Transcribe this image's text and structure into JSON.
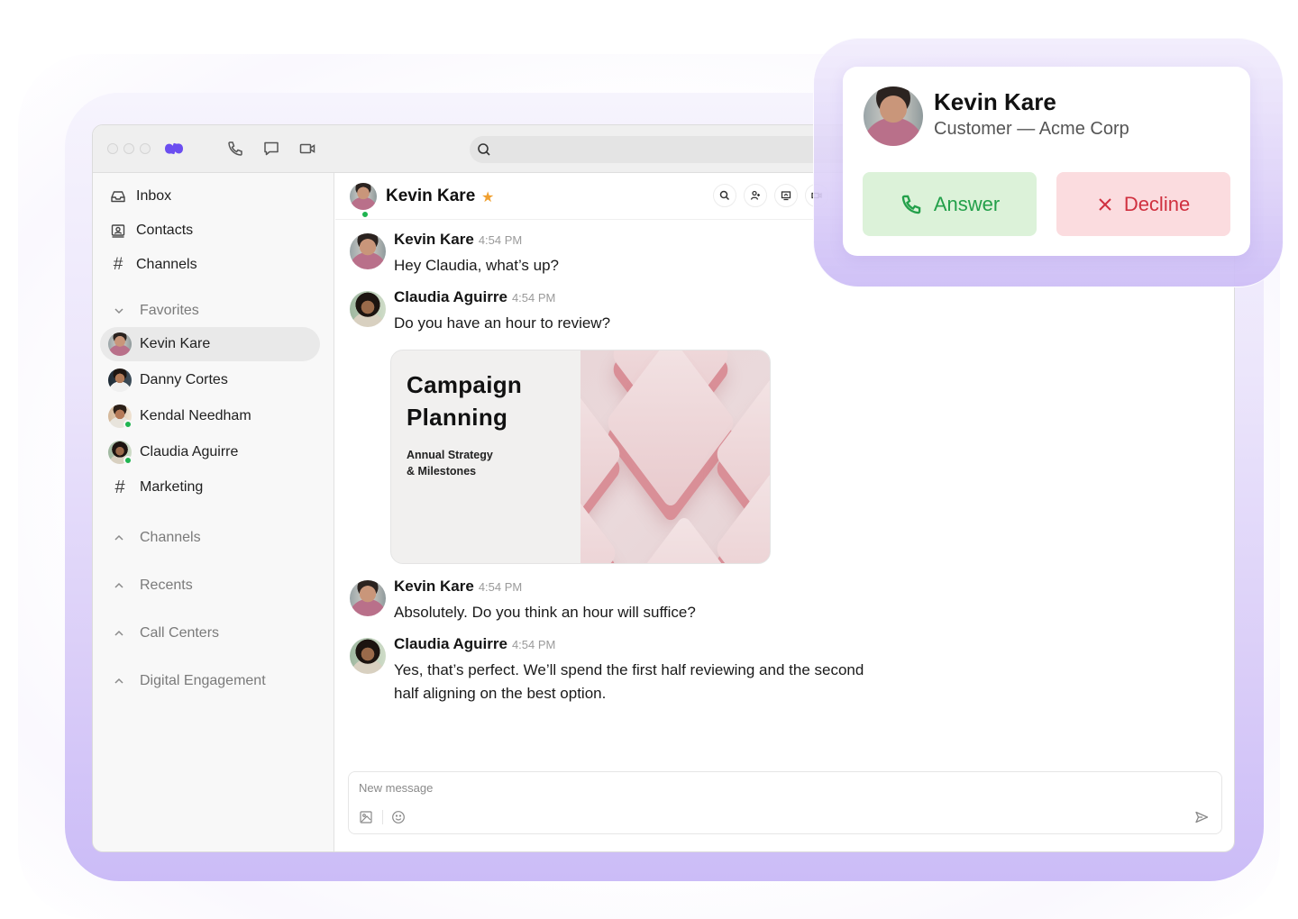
{
  "titlebar": {
    "logo": "app-logo",
    "icons": [
      "phone-icon",
      "chat-bubble-icon",
      "video-camera-icon"
    ],
    "search_placeholder": ""
  },
  "sidebar": {
    "nav": [
      {
        "label": "Inbox",
        "icon": "inbox-icon"
      },
      {
        "label": "Contacts",
        "icon": "contacts-icon"
      },
      {
        "label": "Channels",
        "icon": "hash-icon"
      }
    ],
    "favorites_label": "Favorites",
    "favorites": [
      {
        "label": "Kevin Kare",
        "type": "person",
        "online": false,
        "active": true
      },
      {
        "label": "Danny Cortes",
        "type": "person",
        "online": false,
        "active": false
      },
      {
        "label": "Kendal Needham",
        "type": "person",
        "online": true,
        "active": false
      },
      {
        "label": "Claudia Aguirre",
        "type": "person",
        "online": true,
        "active": false
      },
      {
        "label": "Marketing",
        "type": "channel",
        "online": false,
        "active": false
      }
    ],
    "sections": [
      {
        "label": "Channels"
      },
      {
        "label": "Recents"
      },
      {
        "label": "Call Centers"
      },
      {
        "label": "Digital Engagement"
      }
    ]
  },
  "chat": {
    "header": {
      "name": "Kevin Kare",
      "starred": true,
      "online": true,
      "actions": [
        "search-icon",
        "add-person-icon",
        "screen-share-icon",
        "video-icon"
      ]
    },
    "messages": [
      {
        "author": "Kevin Kare",
        "time": "4:54 PM",
        "text": "Hey Claudia, what’s up?"
      },
      {
        "author": "Claudia Aguirre",
        "time": "4:54 PM",
        "text": "Do you have an hour to review?"
      },
      {
        "author": "Kevin Kare",
        "time": "4:54 PM",
        "text": "Absolutely. Do you think an hour will suffice?"
      },
      {
        "author": "Claudia Aguirre",
        "time": "4:54 PM",
        "text_line1": "Yes, that’s perfect. We’ll spend the first half reviewing and the second",
        "text_line2": "half aligning on the best option."
      }
    ],
    "attachment": {
      "title_line1": "Campaign",
      "title_line2": "Planning",
      "subtitle_line1": "Annual Strategy",
      "subtitle_line2": "& Milestones"
    },
    "composer": {
      "placeholder": "New message"
    }
  },
  "incoming_call": {
    "name": "Kevin Kare",
    "subtitle": "Customer — Acme Corp",
    "answer_label": "Answer",
    "decline_label": "Decline",
    "colors": {
      "answer_bg": "#dcf2d9",
      "answer_fg": "#23a04a",
      "decline_bg": "#fbdcdf",
      "decline_fg": "#d0303f"
    }
  },
  "colors": {
    "brand": "#6b4ef0",
    "frame": "#cbbcf7",
    "online": "#1fb450",
    "star": "#f0a030"
  }
}
